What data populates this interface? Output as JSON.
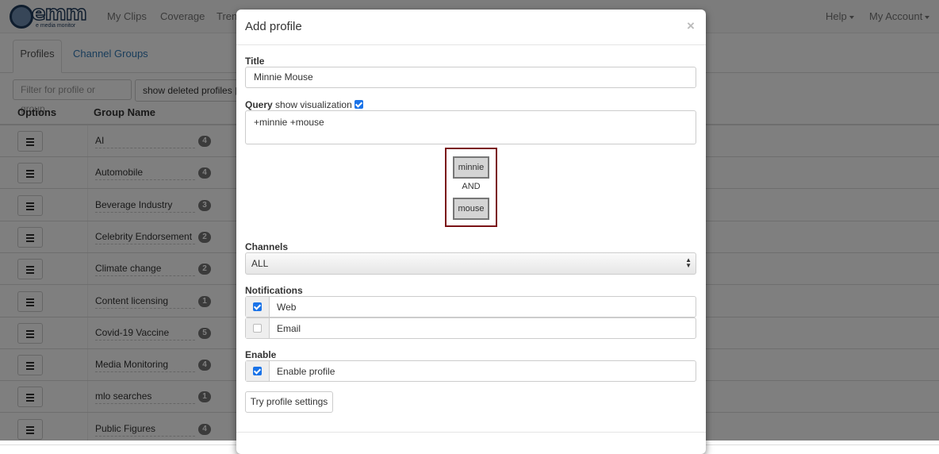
{
  "app": {
    "logo_text": "emm",
    "logo_tagline": "e media monitor",
    "nav": [
      "My Clips",
      "Coverage",
      "Trends"
    ],
    "help": "Help",
    "account": "My Account"
  },
  "tabs": {
    "profiles": "Profiles",
    "channel_groups": "Channel Groups"
  },
  "toolbar": {
    "filter_placeholder": "Filter for profile or group...",
    "show_deleted": "show deleted profiles"
  },
  "table": {
    "headers": {
      "options": "Options",
      "group_name": "Group Name"
    },
    "rows": [
      {
        "name": "AI",
        "count": "4"
      },
      {
        "name": "Automobile",
        "count": "4"
      },
      {
        "name": "Beverage Industry",
        "count": "3"
      },
      {
        "name": "Celebrity Endorsement",
        "count": "2"
      },
      {
        "name": "Climate change",
        "count": "2"
      },
      {
        "name": "Content licensing",
        "count": "1"
      },
      {
        "name": "Covid-19 Vaccine",
        "count": "5"
      },
      {
        "name": "Media Monitoring",
        "count": "4"
      },
      {
        "name": "mlo searches",
        "count": "1"
      },
      {
        "name": "Public Figures",
        "count": "4"
      }
    ]
  },
  "modal": {
    "title": "Add profile",
    "close": "×",
    "title_label": "Title",
    "title_value": "Minnie Mouse",
    "query_label": "Query",
    "show_visualization": "show visualization",
    "query_value": "+minnie +mouse",
    "viz": {
      "term1": "minnie",
      "operator": "AND",
      "term2": "mouse"
    },
    "channels_label": "Channels",
    "channels_value": "ALL",
    "notifications_label": "Notifications",
    "notify_web": "Web",
    "notify_email": "Email",
    "enable_label": "Enable",
    "enable_profile": "Enable profile",
    "try_button": "Try profile settings"
  },
  "state": {
    "show_visualization_checked": true,
    "web_checked": true,
    "email_checked": false,
    "enable_checked": true
  }
}
